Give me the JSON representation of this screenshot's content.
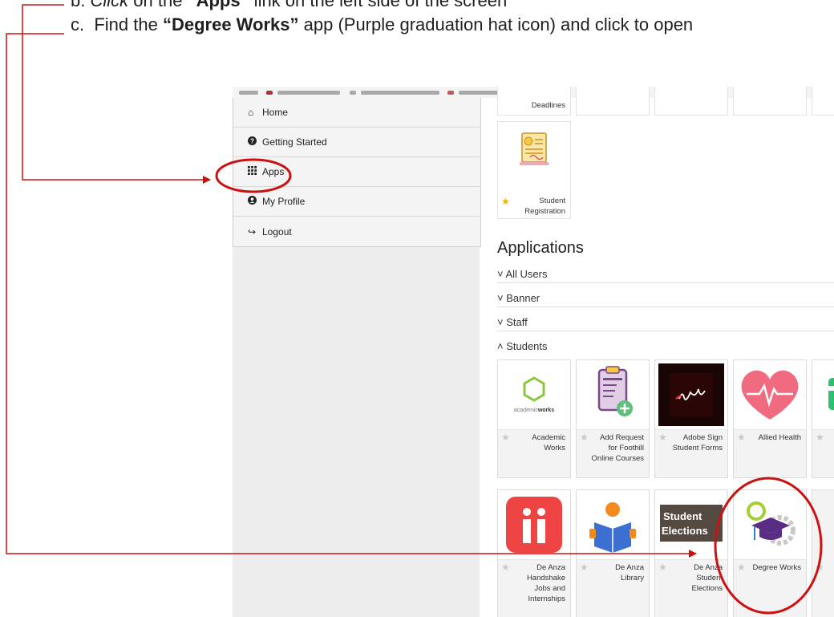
{
  "instructions": {
    "b": {
      "marker": "b.",
      "verb": "Click",
      "pre": "on the ",
      "target": "“Apps”",
      "post": " link on the left side of the screen"
    },
    "c": {
      "marker": "c.",
      "pre": "Find the ",
      "target": "“Degree Works”",
      "post": " app (Purple graduation hat icon) and click to open"
    }
  },
  "sidebar": {
    "items": [
      {
        "icon": "home-icon",
        "glyph": "⌂",
        "label": "Home"
      },
      {
        "icon": "question-circle-icon",
        "glyph": "❓",
        "label": "Getting Started"
      },
      {
        "icon": "grid-icon",
        "glyph": "☷",
        "label": "Apps"
      },
      {
        "icon": "user-circle-icon",
        "glyph": "☺",
        "label": "My Profile"
      },
      {
        "icon": "logout-icon",
        "glyph": "↪",
        "label": "Logout"
      }
    ]
  },
  "top_tiles": {
    "deadlines_label": "Deadlines",
    "registration_label_1": "Student",
    "registration_label_2": "Registration"
  },
  "applications": {
    "heading": "Applications",
    "sections": [
      "˅ All Users",
      "˅ Banner",
      "˅ Staff",
      "˄ Students"
    ]
  },
  "student_apps_row1": [
    {
      "label": "Academic Works",
      "icon": "academic-works-icon"
    },
    {
      "label": "Add Request for Foothill Online Courses",
      "icon": "clipboard-plus-icon"
    },
    {
      "label": "Adobe Sign Student Forms",
      "icon": "adobe-sign-icon"
    },
    {
      "label": "Allied Health",
      "icon": "heart-icon"
    }
  ],
  "student_apps_row2": [
    {
      "label": "De Anza Handshake Jobs and Internships",
      "icon": "handshake-icon"
    },
    {
      "label": "De Anza Library",
      "icon": "reader-icon"
    },
    {
      "label": "De Anza Student Elections",
      "icon": "elections-icon"
    },
    {
      "label": "Degree Works",
      "icon": "graduation-hat-icon"
    }
  ],
  "icon_text": {
    "academicworks_a": "academic",
    "academicworks_b": "works",
    "elections_1": "Student",
    "elections_2": "Elections"
  },
  "colors": {
    "annotation_red": "#cc1111",
    "handshake_red": "#ee4444",
    "heart_pink": "#f06b80",
    "degree_purple": "#5b2c83"
  }
}
